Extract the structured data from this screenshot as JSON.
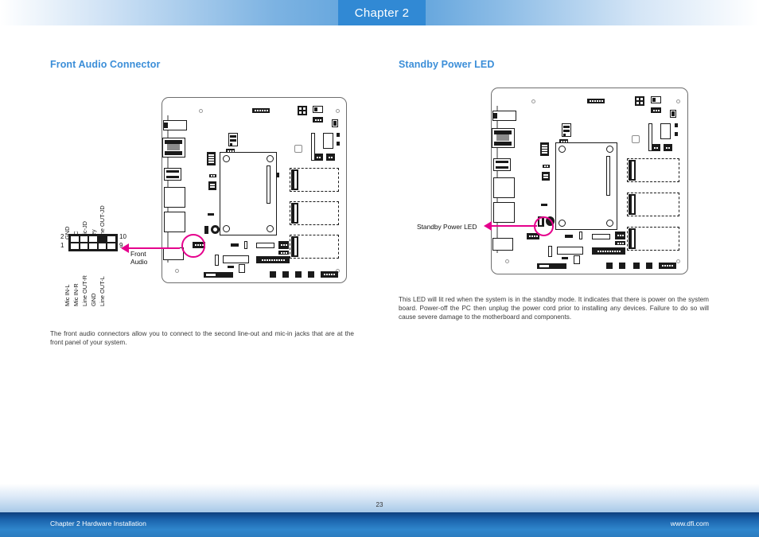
{
  "header": {
    "chapter_tab": "Chapter 2"
  },
  "sections": {
    "left": {
      "heading": "Front Audio Connector",
      "paragraph": "The front audio connectors allow you to connect to the second line-out and mic-in jacks that are at the front panel of your system.",
      "connector_name": "Front\nAudio",
      "connector_name_line1": "Front",
      "connector_name_line2": "Audio",
      "pin_numbers": {
        "top_left": "2",
        "bottom_left": "1",
        "top_right": "10",
        "bottom_right": "9"
      },
      "top_labels": [
        "GND",
        "NC",
        "Mic-JD",
        "Key",
        "Line OUT-JD"
      ],
      "bottom_labels": [
        "Mic IN-L",
        "Mic IN-R",
        "Line OUT-R",
        "GND",
        "Line OUT-L"
      ]
    },
    "right": {
      "heading": "Standby Power LED",
      "callout": "Standby Power LED",
      "paragraph": "This LED will lit red when the system is in the standby mode. It indicates that there is power on the system board. Power-off the PC then unplug the power cord prior to installing any devices. Failure to do so will cause severe damage to the motherboard and components."
    }
  },
  "footer": {
    "page_number": "23",
    "left_text": "Chapter 2 Hardware Installation",
    "right_text": "www.dfi.com"
  },
  "colors": {
    "accent_blue": "#3b8ed8",
    "tab_blue": "#3189d4",
    "highlight_magenta": "#e5008c",
    "footer_blue": "#2f86cc"
  }
}
